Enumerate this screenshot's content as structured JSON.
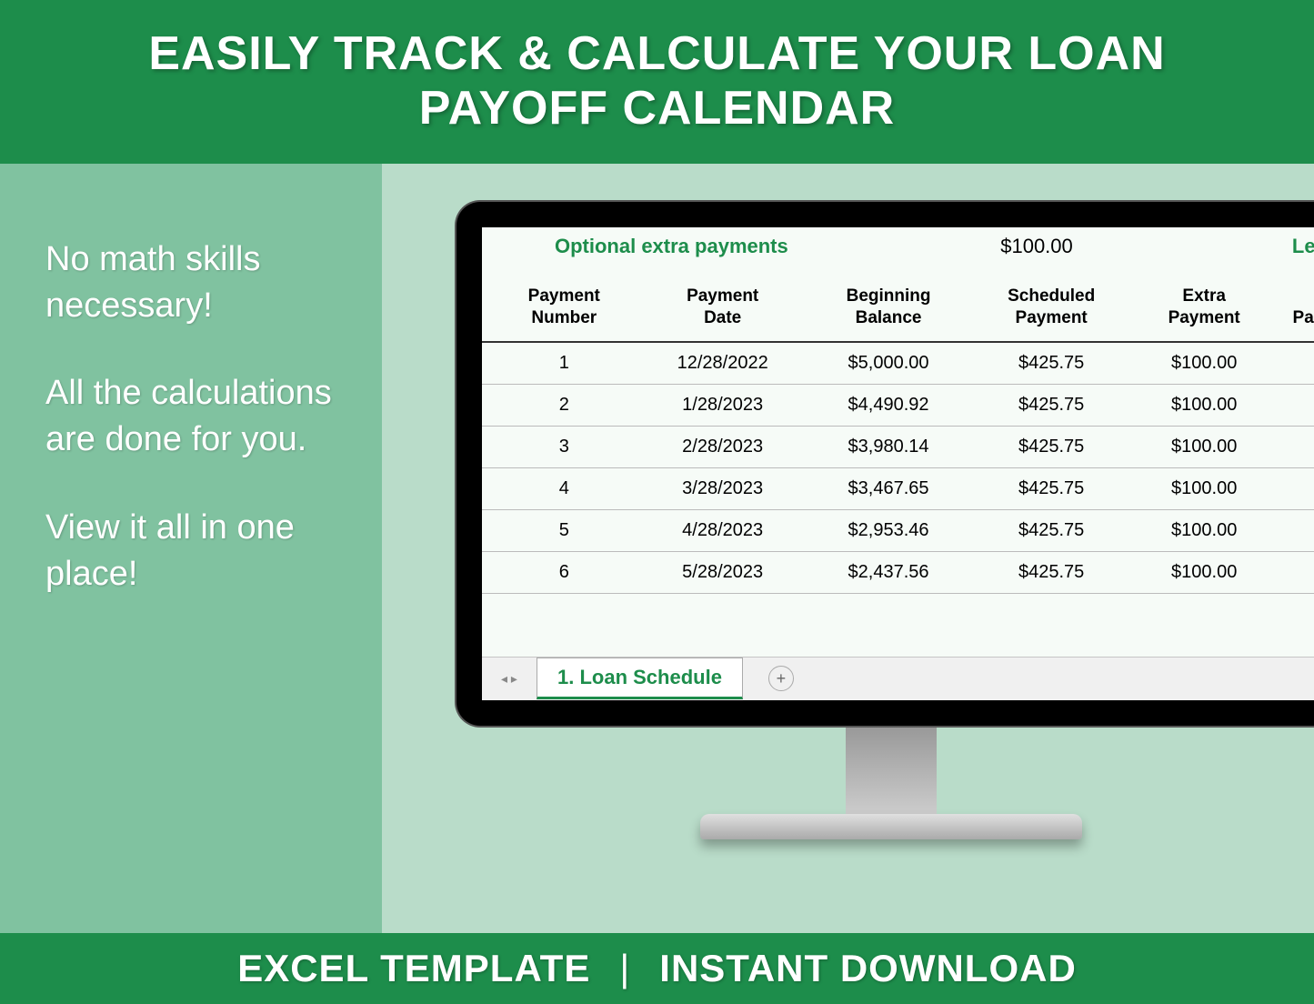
{
  "header": {
    "title_line1": "EASILY TRACK & CALCULATE YOUR LOAN",
    "title_line2": "PAYOFF CALENDAR"
  },
  "bullets": {
    "p1": "No math skills necessary!",
    "p2": "All the calculations are done for you.",
    "p3": "View it all in one place!"
  },
  "sheet": {
    "optional_label": "Optional extra payments",
    "optional_value": "$100.00",
    "len_label": "Len",
    "tab_name": "1. Loan Schedule",
    "columns": [
      "Payment\nNumber",
      "Payment\nDate",
      "Beginning\nBalance",
      "Scheduled\nPayment",
      "Extra\nPayment",
      "Pa"
    ],
    "rows": [
      {
        "num": "1",
        "date": "12/28/2022",
        "begin": "$5,000.00",
        "sched": "$425.75",
        "extra": "$100.00"
      },
      {
        "num": "2",
        "date": "1/28/2023",
        "begin": "$4,490.92",
        "sched": "$425.75",
        "extra": "$100.00"
      },
      {
        "num": "3",
        "date": "2/28/2023",
        "begin": "$3,980.14",
        "sched": "$425.75",
        "extra": "$100.00"
      },
      {
        "num": "4",
        "date": "3/28/2023",
        "begin": "$3,467.65",
        "sched": "$425.75",
        "extra": "$100.00"
      },
      {
        "num": "5",
        "date": "4/28/2023",
        "begin": "$2,953.46",
        "sched": "$425.75",
        "extra": "$100.00"
      },
      {
        "num": "6",
        "date": "5/28/2023",
        "begin": "$2,437.56",
        "sched": "$425.75",
        "extra": "$100.00"
      }
    ]
  },
  "footer": {
    "left": "EXCEL TEMPLATE",
    "right": "INSTANT DOWNLOAD"
  }
}
